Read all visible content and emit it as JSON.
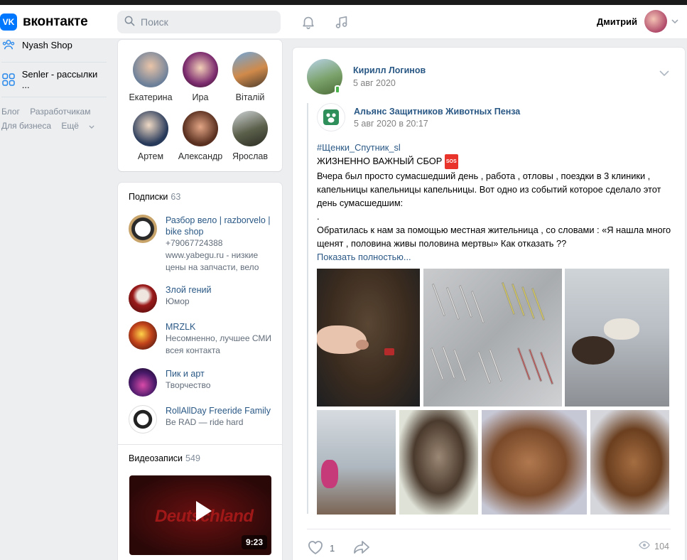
{
  "header": {
    "logo_mark": "VK",
    "logo_text": "вконтакте",
    "search_placeholder": "Поиск",
    "user_name": "Дмитрий"
  },
  "leftmenu": {
    "items": [
      {
        "label": "Nyash Shop",
        "icon": "users-icon"
      },
      {
        "label": "Senler - рассылки ...",
        "icon": "apps-icon"
      }
    ],
    "links": [
      "Блог",
      "Разработчикам",
      "Для бизнеса",
      "Ещё"
    ]
  },
  "friends": [
    {
      "name": "Екатерина"
    },
    {
      "name": "Ира"
    },
    {
      "name": "Віталій"
    },
    {
      "name": "Артем"
    },
    {
      "name": "Александр"
    },
    {
      "name": "Ярослав"
    }
  ],
  "subscriptions": {
    "title": "Подписки",
    "count": "63",
    "items": [
      {
        "name": "Разбор вело | razborvelo | bike shop",
        "desc": "+79067724388 www.yabegu.ru - низкие цены на запчасти, вело"
      },
      {
        "name": "Злой гений",
        "desc": "Юмор"
      },
      {
        "name": "MRZLK",
        "desc": "Несомненно, лучшее СМИ всея контакта"
      },
      {
        "name": "Пик и арт",
        "desc": "Творчество"
      },
      {
        "name": "RollAllDay Freeride Family",
        "desc": "Be RAD — ride hard"
      }
    ]
  },
  "videos": {
    "title": "Видеозаписи",
    "count": "549",
    "thumb_text": "Deutschland",
    "duration": "9:23"
  },
  "post": {
    "author": "Кирилл Логинов",
    "date": "5 авг 2020",
    "repost_author": "Альянс Защитников Животных Пенза",
    "repost_date": "5 авг 2020 в 20:17",
    "hashtag": "#Щенки_Спутник_sl",
    "line1": "ЖИЗНЕННО ВАЖНЫЙ СБОР",
    "sos": "SOS",
    "para1": "Вчера был просто сумасшедший день , работа , отловы , поездки в 3 клиники , капельницы капельницы капельницы. Вот одно из событий которое сделало этот день сумасшедшим:",
    "dot": ".",
    "para2": "Обратилась к нам за помощью местная жительница , со словами : «Я нашла много щенят , половина живы половина мертвы» Как отказать ??",
    "show_more": "Показать полностью...",
    "likes": "1",
    "views": "104"
  },
  "colors": {
    "brand": "#0077ff",
    "link": "#2a5885",
    "online": "#4bb34b"
  }
}
